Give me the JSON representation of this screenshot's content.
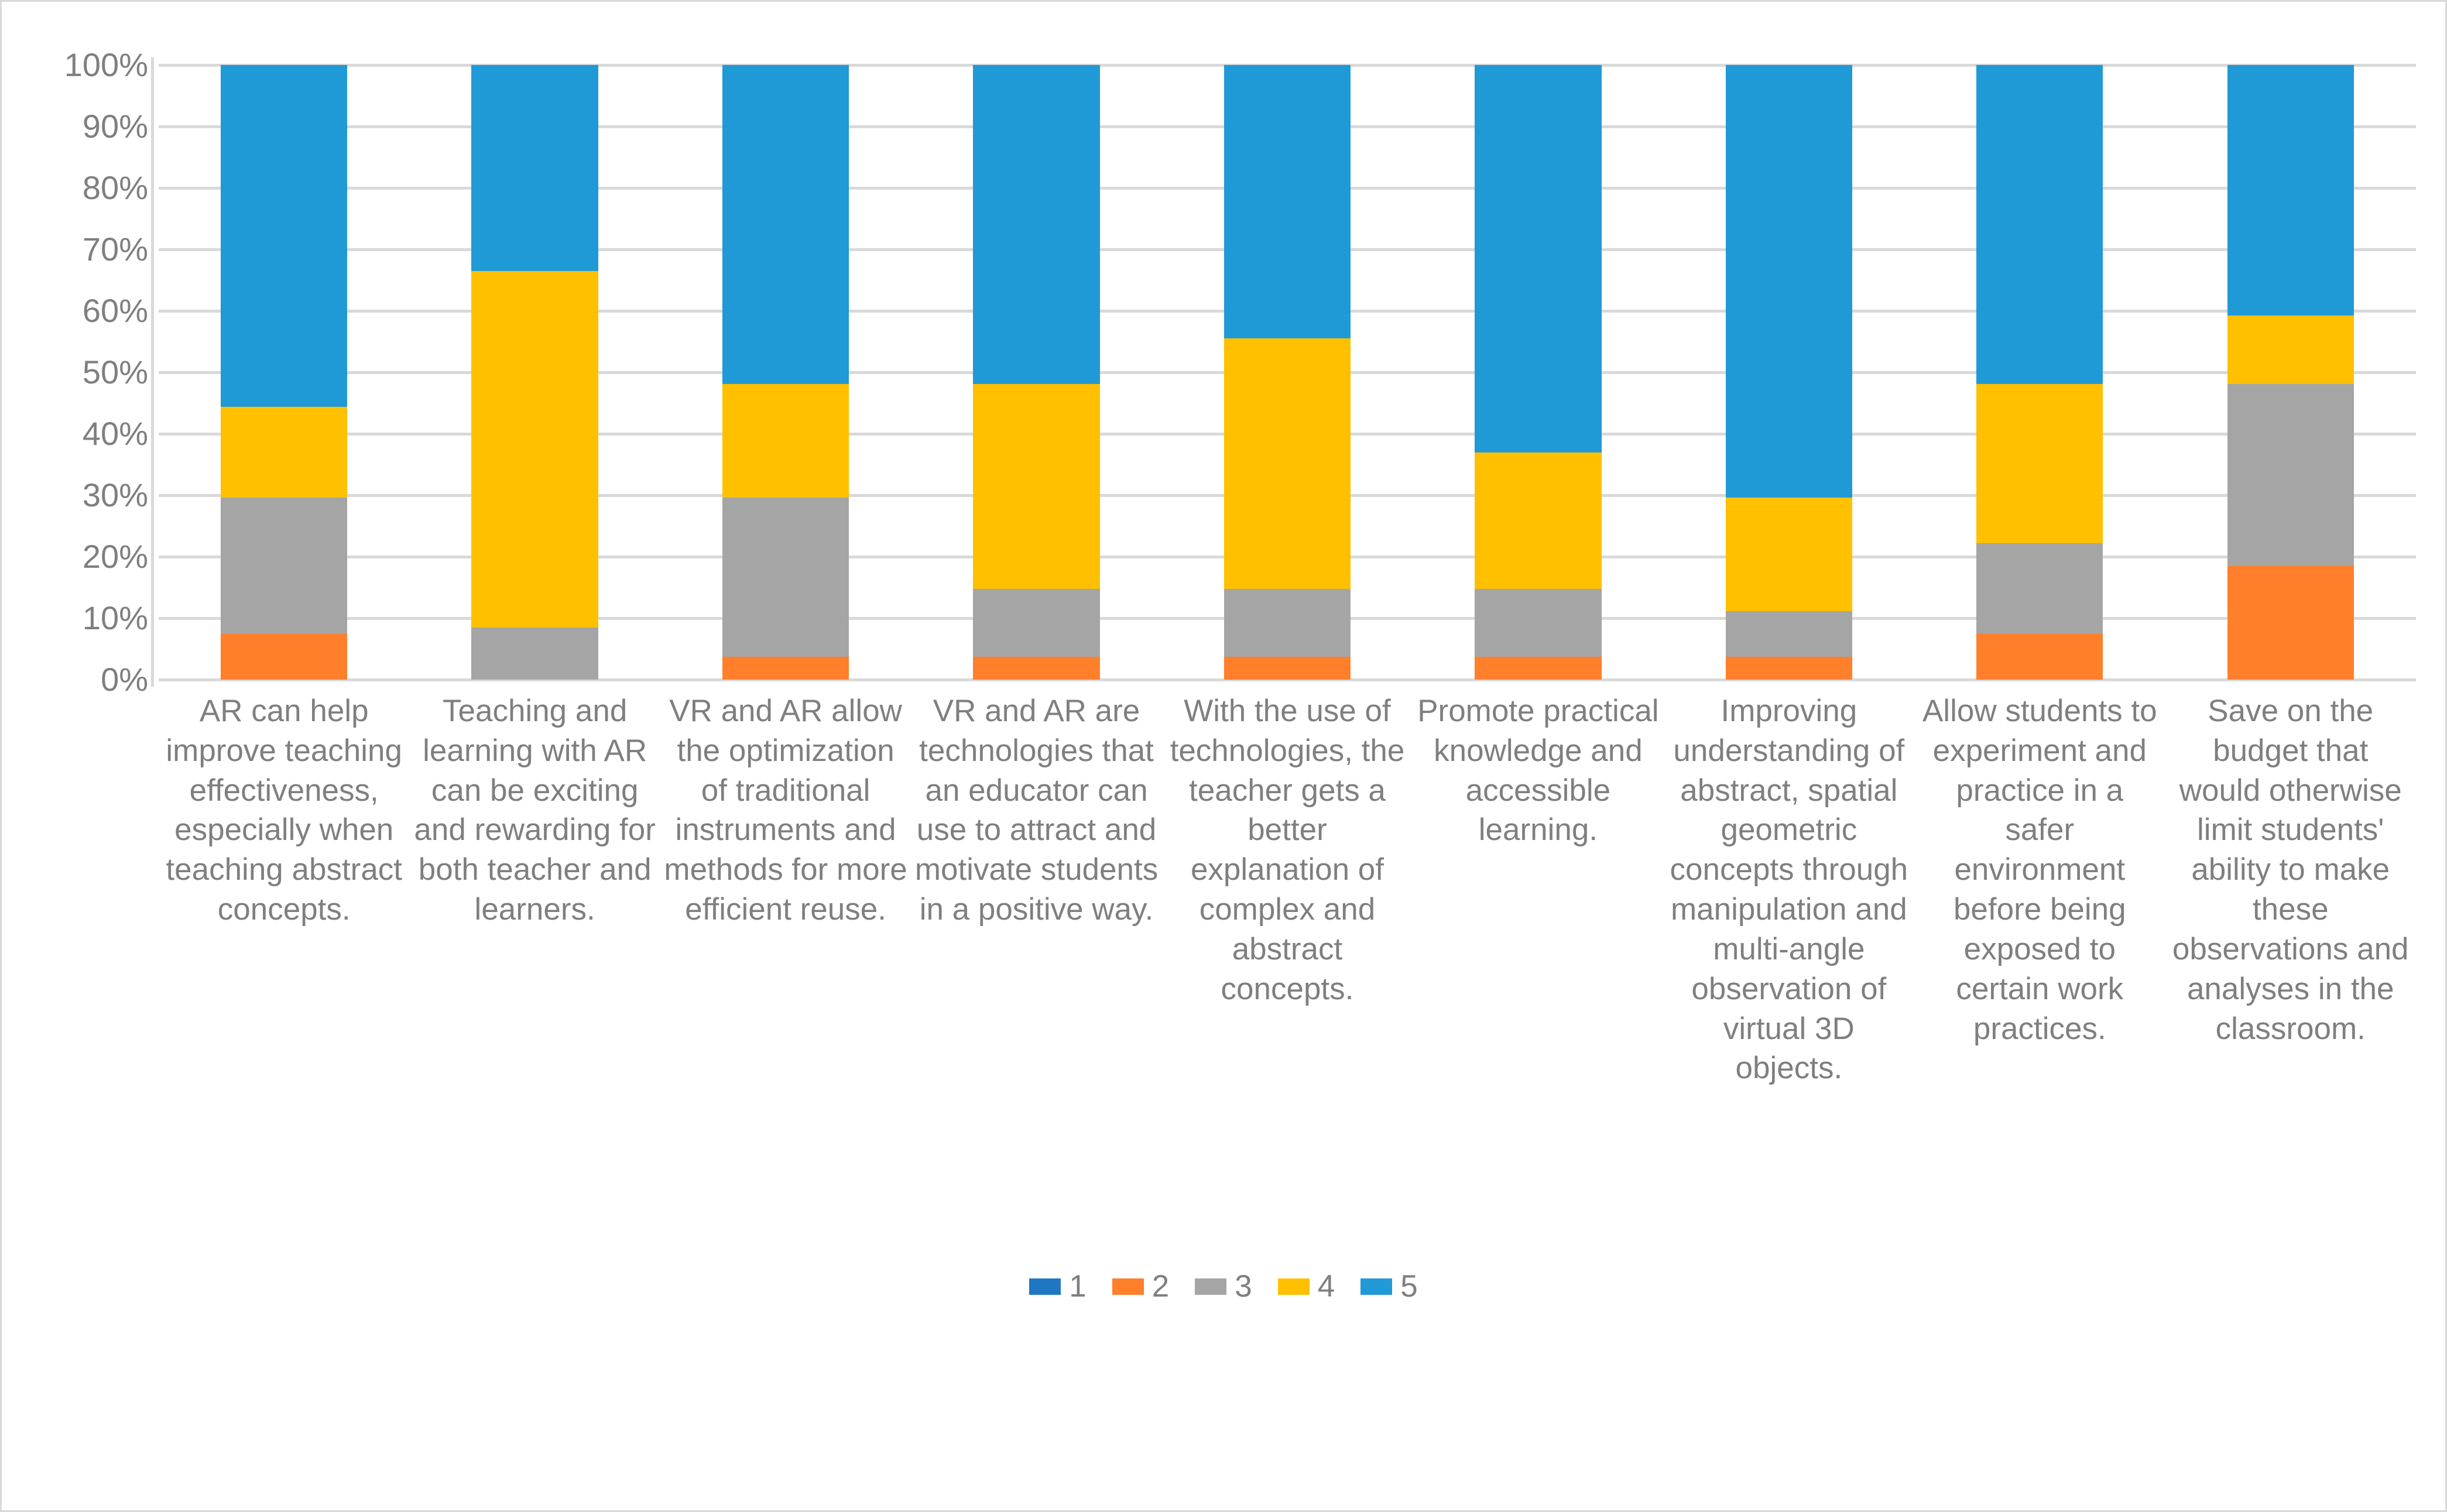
{
  "chart_data": {
    "type": "bar",
    "subtype": "100% stacked column",
    "title": "",
    "xlabel": "",
    "ylabel": "",
    "ylim": [
      0,
      100
    ],
    "grid": true,
    "legend_position": "bottom",
    "y_tick_labels": [
      "100%",
      "90%",
      "80%",
      "70%",
      "60%",
      "50%",
      "40%",
      "30%",
      "20%",
      "10%",
      "0%"
    ],
    "y_ticks": [
      100,
      90,
      80,
      70,
      60,
      50,
      40,
      30,
      20,
      10,
      0
    ],
    "legend": [
      "1",
      "2",
      "3",
      "4",
      "5"
    ],
    "colors": {
      "1": "#1f77c4",
      "2": "#ff7f2a",
      "3": "#a5a5a5",
      "4": "#ffc000",
      "5": "#1f9ad6",
      "gridline": "#d9d9d9",
      "text": "#7f7f7f",
      "border": "#d9d9d9",
      "background": "#ffffff"
    },
    "categories": [
      "AR can help improve teaching effectiveness, especially when teaching abstract concepts.",
      "Teaching and learning with AR can be exciting and rewarding for both teacher and learners.",
      "VR and AR allow the optimization of traditional instruments and methods for more efficient reuse.",
      "VR and AR are technologies that an educator can use to attract and motivate students in a positive way.",
      "With the use of technologies, the teacher gets a better explanation of complex and abstract concepts.",
      "Promote practical knowledge and accessible learning.",
      "Improving understanding of abstract, spatial geometric concepts through manipulation and multi-angle observation of virtual 3D objects.",
      "Allow students to experiment and practice in a safer environment before being exposed to certain work practices.",
      "Save on the budget that would otherwise limit students' ability to make these observations and analyses in the classroom."
    ],
    "series": [
      {
        "name": "1",
        "values": [
          0,
          0,
          0,
          0,
          0,
          0,
          0,
          0,
          0
        ]
      },
      {
        "name": "2",
        "values": [
          7.4,
          0,
          3.7,
          3.7,
          3.7,
          3.7,
          3.7,
          7.4,
          18.5
        ]
      },
      {
        "name": "3",
        "values": [
          22.2,
          8.5,
          25.9,
          11.1,
          11.1,
          11.1,
          7.4,
          14.8,
          29.6
        ]
      },
      {
        "name": "4",
        "values": [
          14.8,
          58.0,
          18.5,
          33.3,
          40.7,
          22.2,
          18.5,
          25.9,
          11.1
        ]
      },
      {
        "name": "5",
        "values": [
          55.6,
          33.5,
          51.9,
          51.9,
          44.5,
          63.0,
          70.4,
          51.9,
          40.8
        ]
      }
    ],
    "cumulative_tops": [
      [
        7.4,
        29.6,
        44.4,
        100.0
      ],
      [
        0.0,
        8.5,
        66.5,
        100.0
      ],
      [
        3.7,
        29.6,
        48.1,
        100.0
      ],
      [
        3.7,
        14.8,
        48.1,
        100.0
      ],
      [
        3.7,
        14.8,
        55.5,
        100.0
      ],
      [
        3.7,
        14.8,
        37.0,
        100.0
      ],
      [
        3.7,
        11.1,
        29.6,
        100.0
      ],
      [
        7.4,
        22.2,
        48.1,
        100.0
      ],
      [
        18.5,
        48.1,
        59.2,
        100.0
      ]
    ]
  }
}
